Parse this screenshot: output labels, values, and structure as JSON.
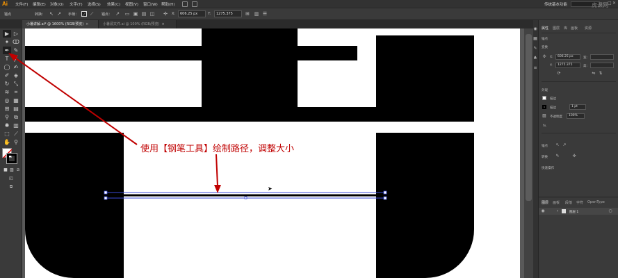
{
  "menubar": {
    "logo": "Ai",
    "items": [
      "文件(F)",
      "编辑(E)",
      "对象(O)",
      "文字(T)",
      "选择(S)",
      "效果(C)",
      "视图(V)",
      "窗口(W)",
      "帮助(H)"
    ],
    "workspace": "传统基本功能",
    "watermark": "虎课网"
  },
  "controlbar": {
    "anchor_label": "锚点",
    "convert_label": "转换：",
    "handle_label": "手柄：",
    "anchor2_label": "锚点：",
    "x_label": "X:",
    "x_value": "606.25 px",
    "y_label": "Y:",
    "y_value": "1275.375"
  },
  "tabs": [
    {
      "label": "小暑讲解.ai* @ 1600% (RGB/预览)",
      "active": true
    },
    {
      "label": "小暑源文件.ai @ 100% (RGB/预览)",
      "active": false
    }
  ],
  "annotation": "使用【钢笔工具】绘制路径，调整大小",
  "properties": {
    "tabs": [
      "属性",
      "图层",
      "库",
      "画板",
      "资源"
    ],
    "section_anchor": "锚点",
    "section_transform": "变换",
    "x_label": "X:",
    "x_value": "606.25 px",
    "y_label": "Y:",
    "y_value": "1275.375",
    "w_label": "宽:",
    "h_label": "高:",
    "section_appearance": "外观",
    "stroke_label": "描边",
    "stroke_row": "描边",
    "stroke_value": "1 pt",
    "opacity_label": "不透明度",
    "opacity_value": "100%",
    "fx_label": "fx.",
    "section_anchor2": "锚点",
    "anchor_convert": "转换",
    "section_quick": "快速操作"
  },
  "layers": {
    "tabs": [
      "图层",
      "画板",
      "段落",
      "字符",
      "OpenType"
    ],
    "layer_name": "图层 1"
  },
  "colors": {
    "accent": "#ff9a00",
    "annotation_red": "#c00000",
    "path_blue": "#3a4ad8"
  }
}
